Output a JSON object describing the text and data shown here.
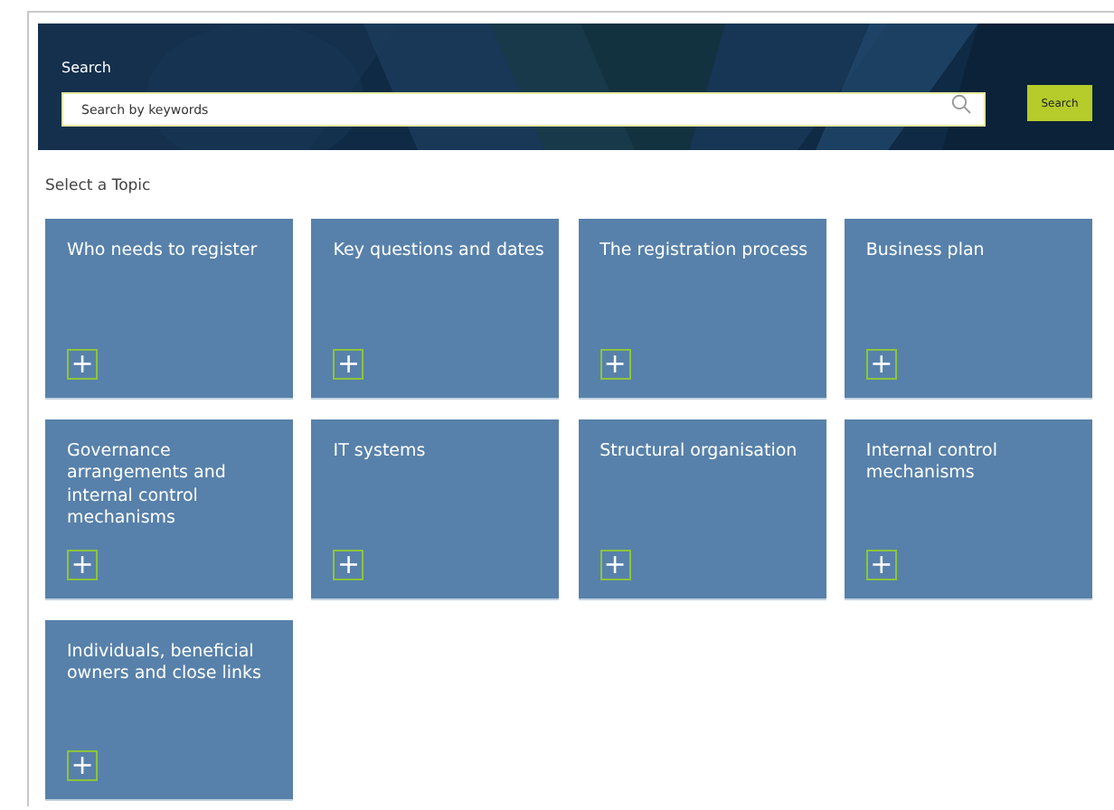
{
  "search": {
    "label": "Search",
    "placeholder": "Search by keywords",
    "button": "Search"
  },
  "heading": "Select a Topic",
  "topics": [
    {
      "title": "Who needs to register",
      "expand": "+"
    },
    {
      "title": "Key questions and dates",
      "expand": "+"
    },
    {
      "title": "The registration process",
      "expand": "+"
    },
    {
      "title": "Business plan",
      "expand": "+"
    },
    {
      "title": "Governance arrangements and internal control mechanisms",
      "expand": "+"
    },
    {
      "title": "IT systems",
      "expand": "+"
    },
    {
      "title": "Structural organisation",
      "expand": "+"
    },
    {
      "title": "Internal control mechanisms",
      "expand": "+"
    },
    {
      "title": "Individuals, beneficial owners and close links",
      "expand": "+"
    }
  ]
}
